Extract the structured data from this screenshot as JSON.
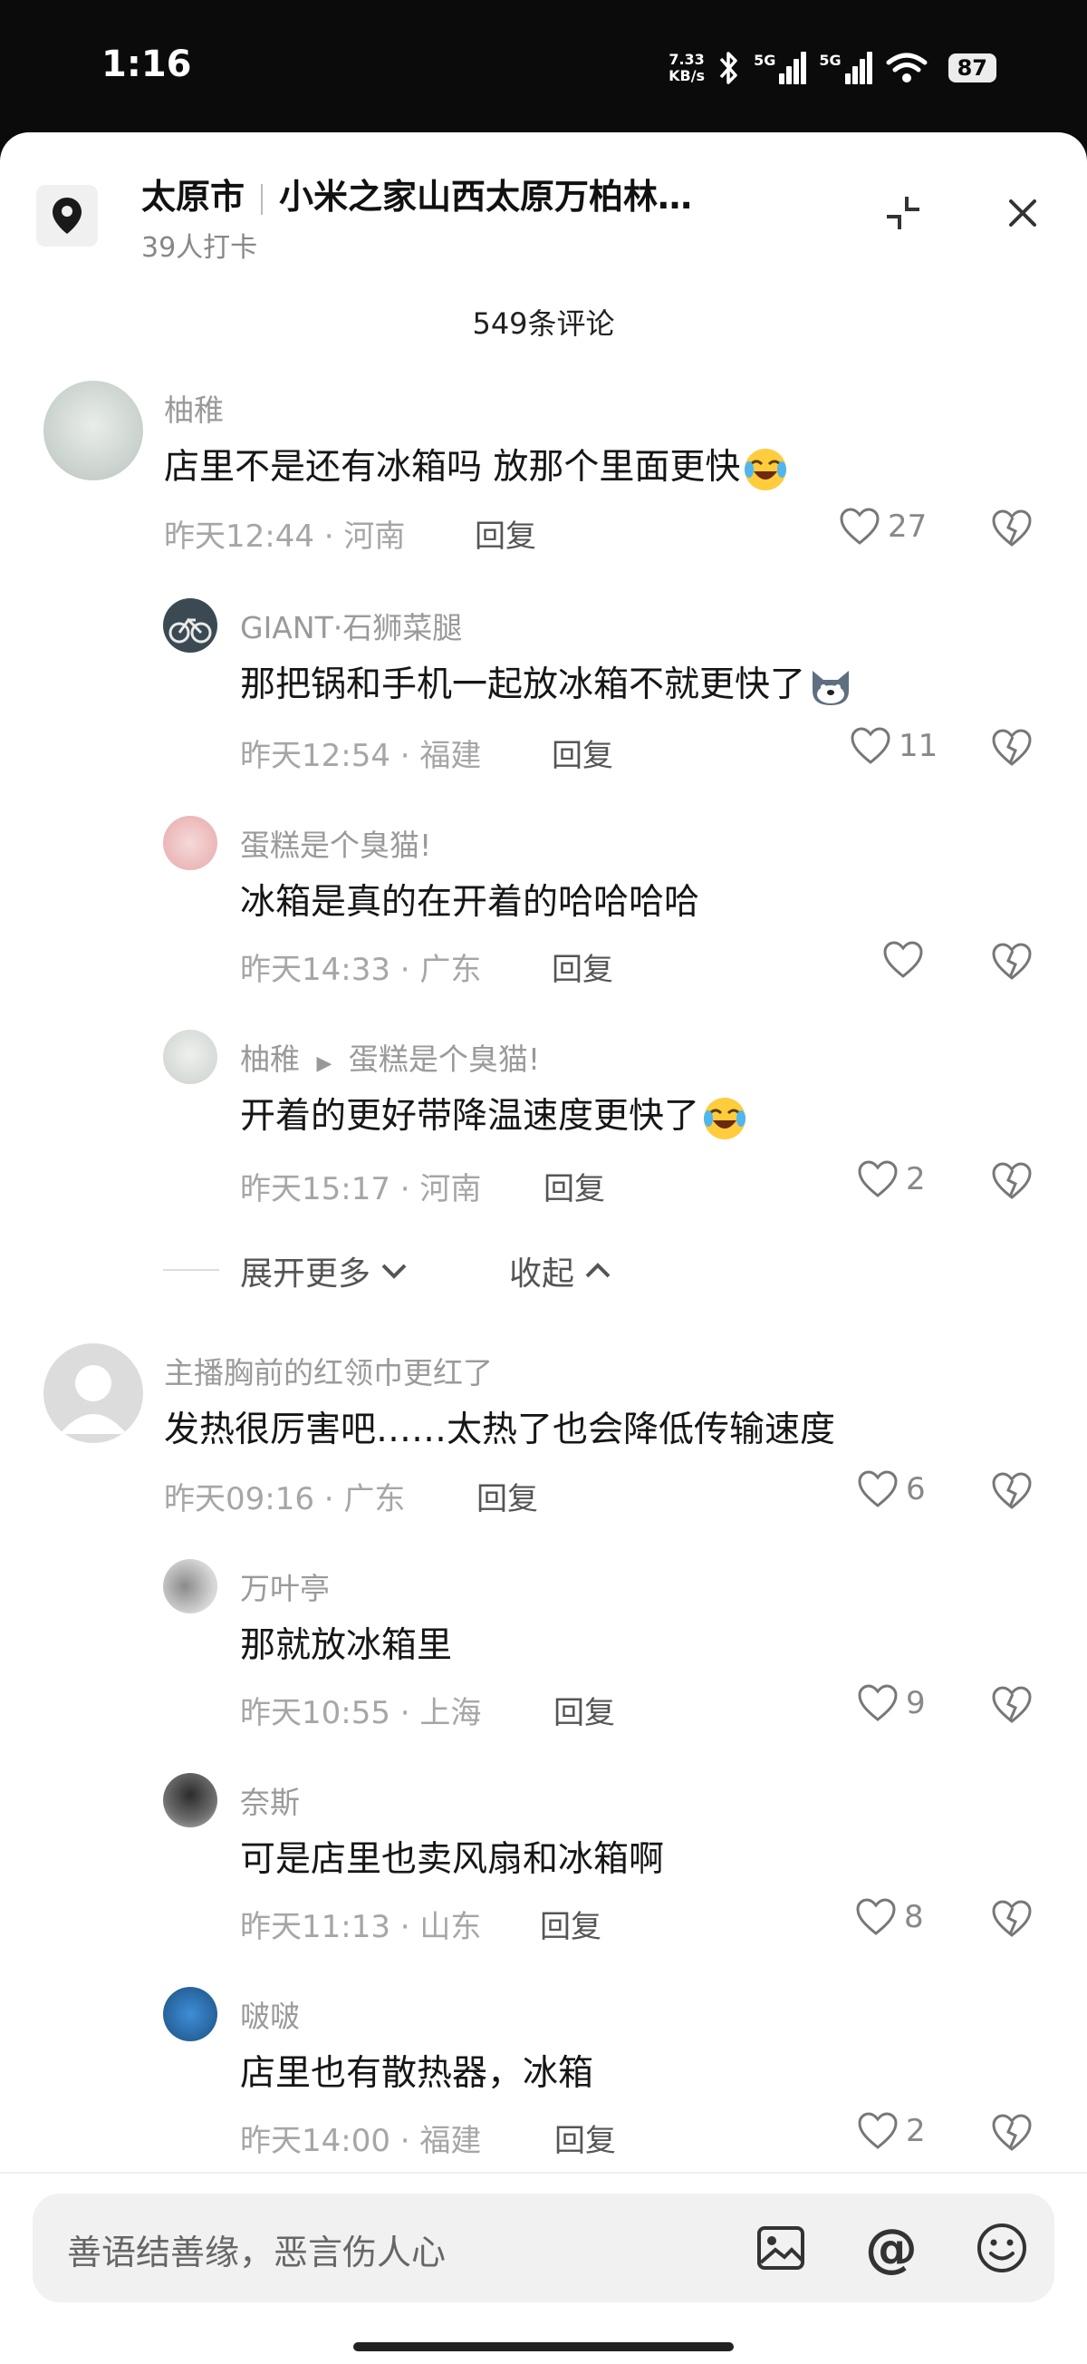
{
  "status_bar": {
    "time": "1:16",
    "speed_value": "7.33",
    "speed_unit": "KB/s",
    "net1": "5G",
    "net2": "5G",
    "battery": "87"
  },
  "header": {
    "city": "太原市",
    "place": "小米之家山西太原万柏林…",
    "checkins": "39人打卡",
    "comment_count": "549条评论"
  },
  "comments": [
    {
      "user": "柚稚",
      "text": "店里不是还有冰箱吗 放那个里面更快",
      "time": "昨天12:44",
      "region": "河南",
      "reply": "回复",
      "likes": "27",
      "emoji": "laugh-cry-emoji"
    },
    {
      "user": "GIANT·石狮菜腿",
      "text": "那把锅和手机一起放冰箱不就更快了",
      "time": "昨天12:54",
      "region": "福建",
      "reply": "回复",
      "likes": "11",
      "emoji": "dog-emoji"
    },
    {
      "user": "蛋糕是个臭猫!",
      "text": "冰箱是真的在开着的哈哈哈哈",
      "time": "昨天14:33",
      "region": "广东",
      "reply": "回复",
      "likes": ""
    },
    {
      "user": "柚稚",
      "reply_to": "蛋糕是个臭猫!",
      "text": "开着的更好带降温速度更快了",
      "time": "昨天15:17",
      "region": "河南",
      "reply": "回复",
      "likes": "2",
      "emoji": "laugh-cry-emoji"
    },
    {
      "user": "主播胸前的红领巾更红了",
      "text": "发热很厉害吧……太热了也会降低传输速度",
      "time": "昨天09:16",
      "region": "广东",
      "reply": "回复",
      "likes": "6"
    },
    {
      "user": "万叶亭",
      "text": "那就放冰箱里",
      "time": "昨天10:55",
      "region": "上海",
      "reply": "回复",
      "likes": "9"
    },
    {
      "user": "奈斯",
      "text": "可是店里也卖风扇和冰箱啊",
      "time": "昨天11:13",
      "region": "山东",
      "reply": "回复",
      "likes": "8"
    },
    {
      "user": "啵啵",
      "text": "店里也有散热器，冰箱",
      "time": "昨天14:00",
      "region": "福建",
      "reply": "回复",
      "likes": "2"
    }
  ],
  "thread_controls": {
    "expand": "展开更多",
    "collapse": "收起"
  },
  "input": {
    "placeholder": "善语结善缘，恶言伤人心"
  }
}
